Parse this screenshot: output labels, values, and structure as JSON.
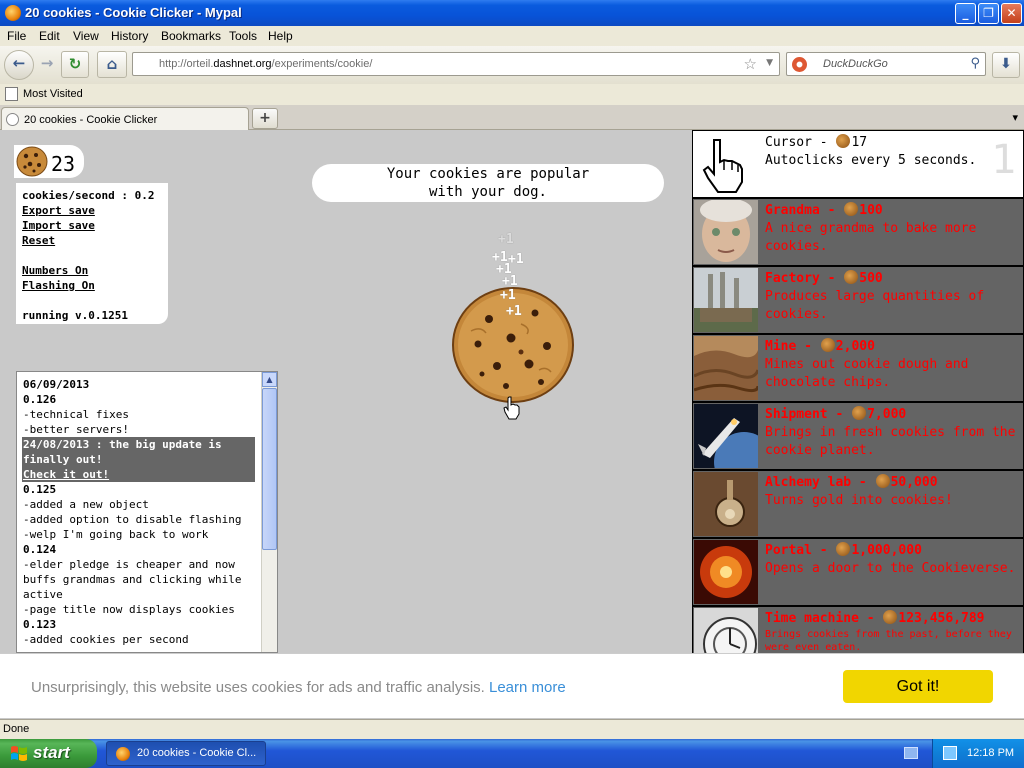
{
  "window": {
    "title": "20 cookies - Cookie Clicker - Mypal",
    "controls": {
      "minimize": "_",
      "maximize": "❐",
      "close": "✕"
    }
  },
  "menubar": [
    "File",
    "Edit",
    "View",
    "History",
    "Bookmarks",
    "Tools",
    "Help"
  ],
  "navigation": {
    "back": "←",
    "forward": "→",
    "reload": "↻",
    "home": "⌂",
    "url_prefix": "http://orteil.",
    "url_domain": "dashnet.org",
    "url_suffix": "/experiments/cookie/",
    "search_placeholder": "DuckDuckGo",
    "download": "⬇"
  },
  "bookmarks": {
    "most_visited": "Most Visited"
  },
  "tabs": [
    {
      "label": "20 cookies - Cookie Clicker"
    }
  ],
  "new_tab": "+",
  "game": {
    "cookie_count": "23",
    "info": {
      "cps": "cookies/second : 0.2",
      "export": "Export save",
      "import": "Import save",
      "reset": "Reset",
      "numbers": "Numbers On",
      "flashing": "Flashing On",
      "version": "running v.0.1251"
    },
    "toast_line1": "Your cookies are popular",
    "toast_line2": "with your dog.",
    "floaters": [
      "+1",
      "+1",
      "+1",
      "+1",
      "+1",
      "+1",
      "+1"
    ],
    "log": {
      "date1": "06/09/2013",
      "v1": "0.126",
      "l1": "-technical fixes",
      "l2": "-better servers!",
      "hl1": "24/08/2013 : the big update is",
      "hl2": "finally out!",
      "hl_link": "Check it out!",
      "v2": "0.125",
      "l3": "-added a new object",
      "l4": "-added option to disable flashing",
      "l5": "-welp I'm going back to work",
      "v3": "0.124",
      "l6": "-elder pledge is cheaper and now",
      "l7": "buffs grandmas and clicking while",
      "l8": "active",
      "l9": "-page title now displays cookies",
      "v4": "0.123",
      "l10": "-added cookies per second"
    },
    "store": [
      {
        "name": "Cursor - ",
        "price": "17",
        "desc": "Autoclicks every 5 seconds.",
        "owned": "1",
        "affordable": true
      },
      {
        "name": "Grandma - ",
        "price": "100",
        "desc": "A nice grandma to bake more cookies."
      },
      {
        "name": "Factory - ",
        "price": "500",
        "desc": "Produces large quantities of cookies."
      },
      {
        "name": "Mine - ",
        "price": "2,000",
        "desc": "Mines out cookie dough and chocolate chips."
      },
      {
        "name": "Shipment - ",
        "price": "7,000",
        "desc": "Brings in fresh cookies from the cookie planet."
      },
      {
        "name": "Alchemy lab - ",
        "price": "50,000",
        "desc": "Turns gold into cookies!"
      },
      {
        "name": "Portal - ",
        "price": "1,000,000",
        "desc": "Opens a door to the Cookieverse."
      },
      {
        "name": "Time machine - ",
        "price": "123,456,789",
        "desc": "Brings cookies from the past, before they were even eaten."
      }
    ]
  },
  "consent": {
    "message": "Unsurprisingly, this website uses cookies for ads and traffic analysis.",
    "learn_more": "Learn more",
    "button": "Got it!"
  },
  "status": "Done",
  "taskbar": {
    "start": "start",
    "task": "20 cookies - Cookie Cl...",
    "clock": "12:18 PM"
  }
}
